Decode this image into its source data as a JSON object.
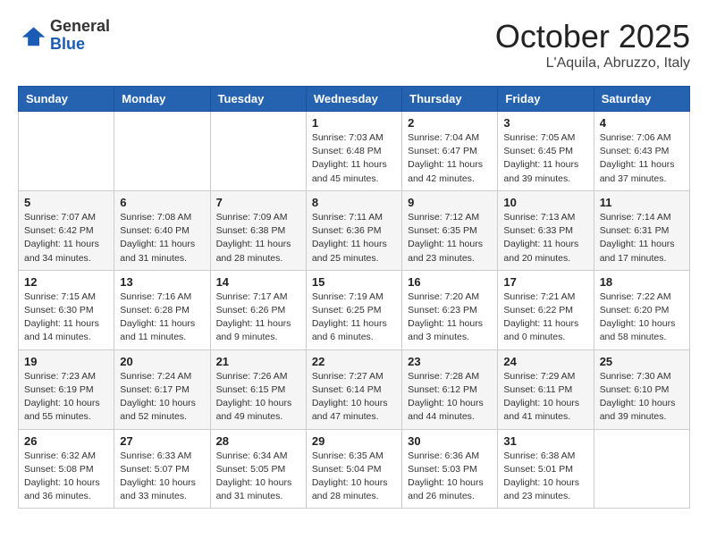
{
  "header": {
    "logo_general": "General",
    "logo_blue": "Blue",
    "month_title": "October 2025",
    "location": "L'Aquila, Abruzzo, Italy"
  },
  "weekdays": [
    "Sunday",
    "Monday",
    "Tuesday",
    "Wednesday",
    "Thursday",
    "Friday",
    "Saturday"
  ],
  "weeks": [
    [
      {
        "day": "",
        "info": ""
      },
      {
        "day": "",
        "info": ""
      },
      {
        "day": "",
        "info": ""
      },
      {
        "day": "1",
        "info": "Sunrise: 7:03 AM\nSunset: 6:48 PM\nDaylight: 11 hours\nand 45 minutes."
      },
      {
        "day": "2",
        "info": "Sunrise: 7:04 AM\nSunset: 6:47 PM\nDaylight: 11 hours\nand 42 minutes."
      },
      {
        "day": "3",
        "info": "Sunrise: 7:05 AM\nSunset: 6:45 PM\nDaylight: 11 hours\nand 39 minutes."
      },
      {
        "day": "4",
        "info": "Sunrise: 7:06 AM\nSunset: 6:43 PM\nDaylight: 11 hours\nand 37 minutes."
      }
    ],
    [
      {
        "day": "5",
        "info": "Sunrise: 7:07 AM\nSunset: 6:42 PM\nDaylight: 11 hours\nand 34 minutes."
      },
      {
        "day": "6",
        "info": "Sunrise: 7:08 AM\nSunset: 6:40 PM\nDaylight: 11 hours\nand 31 minutes."
      },
      {
        "day": "7",
        "info": "Sunrise: 7:09 AM\nSunset: 6:38 PM\nDaylight: 11 hours\nand 28 minutes."
      },
      {
        "day": "8",
        "info": "Sunrise: 7:11 AM\nSunset: 6:36 PM\nDaylight: 11 hours\nand 25 minutes."
      },
      {
        "day": "9",
        "info": "Sunrise: 7:12 AM\nSunset: 6:35 PM\nDaylight: 11 hours\nand 23 minutes."
      },
      {
        "day": "10",
        "info": "Sunrise: 7:13 AM\nSunset: 6:33 PM\nDaylight: 11 hours\nand 20 minutes."
      },
      {
        "day": "11",
        "info": "Sunrise: 7:14 AM\nSunset: 6:31 PM\nDaylight: 11 hours\nand 17 minutes."
      }
    ],
    [
      {
        "day": "12",
        "info": "Sunrise: 7:15 AM\nSunset: 6:30 PM\nDaylight: 11 hours\nand 14 minutes."
      },
      {
        "day": "13",
        "info": "Sunrise: 7:16 AM\nSunset: 6:28 PM\nDaylight: 11 hours\nand 11 minutes."
      },
      {
        "day": "14",
        "info": "Sunrise: 7:17 AM\nSunset: 6:26 PM\nDaylight: 11 hours\nand 9 minutes."
      },
      {
        "day": "15",
        "info": "Sunrise: 7:19 AM\nSunset: 6:25 PM\nDaylight: 11 hours\nand 6 minutes."
      },
      {
        "day": "16",
        "info": "Sunrise: 7:20 AM\nSunset: 6:23 PM\nDaylight: 11 hours\nand 3 minutes."
      },
      {
        "day": "17",
        "info": "Sunrise: 7:21 AM\nSunset: 6:22 PM\nDaylight: 11 hours\nand 0 minutes."
      },
      {
        "day": "18",
        "info": "Sunrise: 7:22 AM\nSunset: 6:20 PM\nDaylight: 10 hours\nand 58 minutes."
      }
    ],
    [
      {
        "day": "19",
        "info": "Sunrise: 7:23 AM\nSunset: 6:19 PM\nDaylight: 10 hours\nand 55 minutes."
      },
      {
        "day": "20",
        "info": "Sunrise: 7:24 AM\nSunset: 6:17 PM\nDaylight: 10 hours\nand 52 minutes."
      },
      {
        "day": "21",
        "info": "Sunrise: 7:26 AM\nSunset: 6:15 PM\nDaylight: 10 hours\nand 49 minutes."
      },
      {
        "day": "22",
        "info": "Sunrise: 7:27 AM\nSunset: 6:14 PM\nDaylight: 10 hours\nand 47 minutes."
      },
      {
        "day": "23",
        "info": "Sunrise: 7:28 AM\nSunset: 6:12 PM\nDaylight: 10 hours\nand 44 minutes."
      },
      {
        "day": "24",
        "info": "Sunrise: 7:29 AM\nSunset: 6:11 PM\nDaylight: 10 hours\nand 41 minutes."
      },
      {
        "day": "25",
        "info": "Sunrise: 7:30 AM\nSunset: 6:10 PM\nDaylight: 10 hours\nand 39 minutes."
      }
    ],
    [
      {
        "day": "26",
        "info": "Sunrise: 6:32 AM\nSunset: 5:08 PM\nDaylight: 10 hours\nand 36 minutes."
      },
      {
        "day": "27",
        "info": "Sunrise: 6:33 AM\nSunset: 5:07 PM\nDaylight: 10 hours\nand 33 minutes."
      },
      {
        "day": "28",
        "info": "Sunrise: 6:34 AM\nSunset: 5:05 PM\nDaylight: 10 hours\nand 31 minutes."
      },
      {
        "day": "29",
        "info": "Sunrise: 6:35 AM\nSunset: 5:04 PM\nDaylight: 10 hours\nand 28 minutes."
      },
      {
        "day": "30",
        "info": "Sunrise: 6:36 AM\nSunset: 5:03 PM\nDaylight: 10 hours\nand 26 minutes."
      },
      {
        "day": "31",
        "info": "Sunrise: 6:38 AM\nSunset: 5:01 PM\nDaylight: 10 hours\nand 23 minutes."
      },
      {
        "day": "",
        "info": ""
      }
    ]
  ]
}
